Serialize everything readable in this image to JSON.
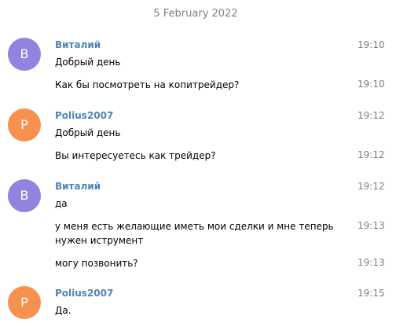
{
  "date_header": "5 February 2022",
  "colors": {
    "avatar_v": "#9183e0",
    "avatar_p": "#f79150",
    "sender": "#4f84b8",
    "time": "#7f7f7f"
  },
  "groups": [
    {
      "avatar_letter": "В",
      "sender": "Виталий",
      "sender_time": "19:10",
      "messages": [
        {
          "text": "Добрый день",
          "time": ""
        },
        {
          "text": "Как бы посмотреть на копитрейдер?",
          "time": "19:10"
        }
      ]
    },
    {
      "avatar_letter": "P",
      "sender": "Polius2007",
      "sender_time": "19:12",
      "messages": [
        {
          "text": "Добрый день",
          "time": ""
        },
        {
          "text": "Вы интересуетесь как трейдер?",
          "time": "19:12"
        }
      ]
    },
    {
      "avatar_letter": "В",
      "sender": "Виталий",
      "sender_time": "19:12",
      "messages": [
        {
          "text": "да",
          "time": ""
        },
        {
          "text": "у меня есть желающие иметь мои сделки и мне теперь нужен иструмент",
          "time": "19:13"
        },
        {
          "text": "могу позвонить?",
          "time": "19:13"
        }
      ]
    },
    {
      "avatar_letter": "P",
      "sender": "Polius2007",
      "sender_time": "19:15",
      "messages": [
        {
          "text": "Да.",
          "time": ""
        }
      ]
    }
  ]
}
